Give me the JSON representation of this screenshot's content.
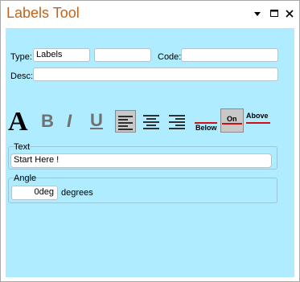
{
  "window": {
    "title": "Labels Tool"
  },
  "form": {
    "type_label": "Type:",
    "type_value": "Labels",
    "type_extra_value": "",
    "code_label": "Code:",
    "code_value": "",
    "desc_label": "Desc:",
    "desc_value": ""
  },
  "toolbar": {
    "font_glyph": "A",
    "bold_glyph": "B",
    "italic_glyph": "I",
    "underline_glyph": "U",
    "selected_alignment": "left",
    "selected_position": "On",
    "position_below_label": "Below",
    "position_on_label": "On",
    "position_above_label": "Above"
  },
  "text_group": {
    "title": "Text",
    "value": "Start Here !"
  },
  "angle_group": {
    "title": "Angle",
    "value": "0deg",
    "unit_label": "degrees"
  },
  "colors": {
    "title_text": "#c0641c",
    "panel_background": "#b0ecff",
    "line_accent": "#d01010"
  }
}
